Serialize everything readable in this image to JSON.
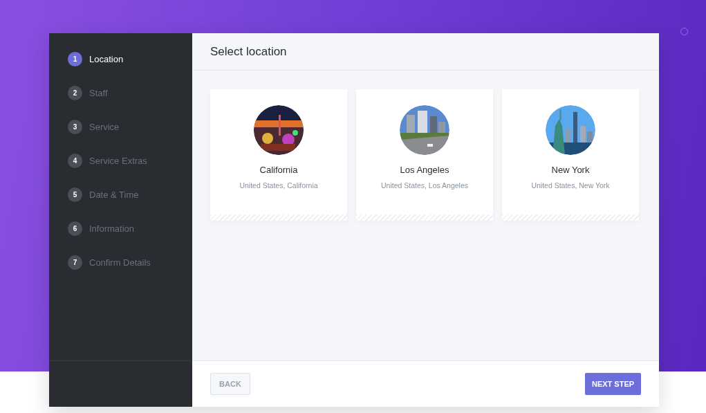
{
  "steps": [
    {
      "number": "1",
      "label": "Location",
      "selected": true
    },
    {
      "number": "2",
      "label": "Staff",
      "selected": false
    },
    {
      "number": "3",
      "label": "Service",
      "selected": false
    },
    {
      "number": "4",
      "label": "Service Extras",
      "selected": false
    },
    {
      "number": "5",
      "label": "Date & Time",
      "selected": false
    },
    {
      "number": "6",
      "label": "Information",
      "selected": false
    },
    {
      "number": "7",
      "label": "Confirm Details",
      "selected": false
    }
  ],
  "header": {
    "title": "Select location"
  },
  "locations": [
    {
      "name": "California",
      "address": "United States, California",
      "kind": "picture"
    },
    {
      "name": "Los Angeles",
      "address": "United States, Los Angeles",
      "kind": "picture"
    },
    {
      "name": "New York",
      "address": "United States, New York",
      "kind": "picture"
    }
  ],
  "footer": {
    "back": "BACK",
    "next": "NEXT STEP"
  }
}
